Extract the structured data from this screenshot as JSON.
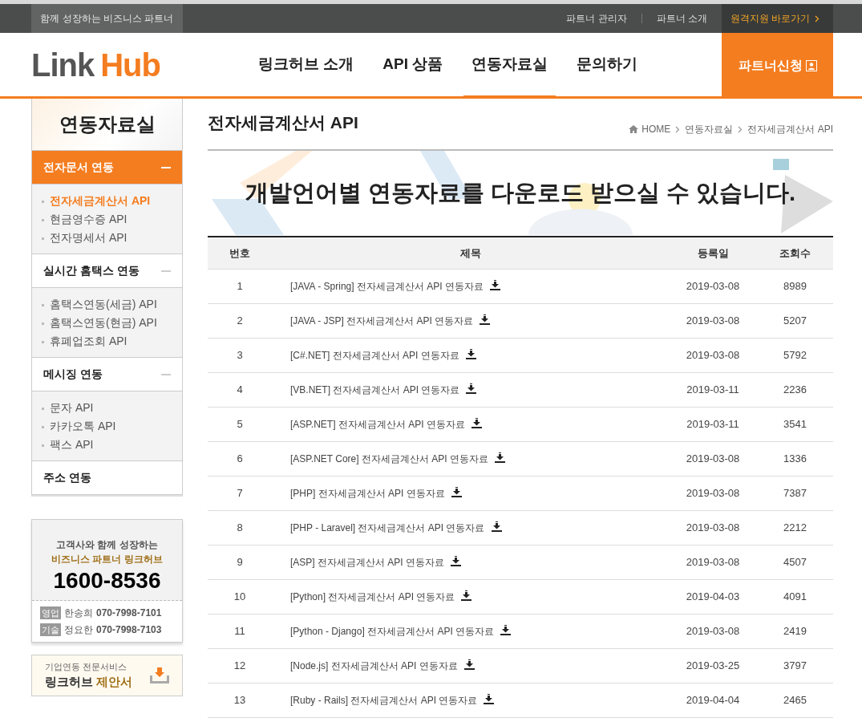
{
  "top_bar": {
    "tagline": "함께 성장하는 비즈니스 파트너",
    "links": [
      "파트너 관리자",
      "파트너 소개"
    ],
    "remote_link": "원격지원 바로가기"
  },
  "header": {
    "logo": {
      "part_1": "Link",
      "part_2": "Hub"
    },
    "nav": [
      {
        "label": "링크허브 소개",
        "selected": false
      },
      {
        "label": "API 상품",
        "selected": false
      },
      {
        "label": "연동자료실",
        "selected": true
      },
      {
        "label": "문의하기",
        "selected": false
      }
    ],
    "partner_button": "파트너신청"
  },
  "sidebar": {
    "title": "연동자료실",
    "groups": [
      {
        "label": "전자문서 연동",
        "selected": true,
        "expanded": true,
        "items": [
          {
            "label": "전자세금계산서 API",
            "selected": true
          },
          {
            "label": "현금영수증 API",
            "selected": false
          },
          {
            "label": "전자명세서 API",
            "selected": false
          }
        ]
      },
      {
        "label": "실시간 홈택스 연동",
        "selected": false,
        "expanded": true,
        "items": [
          {
            "label": "홈택스연동(세금) API",
            "selected": false
          },
          {
            "label": "홈택스연동(현금) API",
            "selected": false
          },
          {
            "label": "휴폐업조회 API",
            "selected": false
          }
        ]
      },
      {
        "label": "메시징 연동",
        "selected": false,
        "expanded": true,
        "items": [
          {
            "label": "문자 API",
            "selected": false
          },
          {
            "label": "카카오톡 API",
            "selected": false
          },
          {
            "label": "팩스 API",
            "selected": false
          }
        ]
      },
      {
        "label": "주소 연동",
        "selected": false,
        "expanded": false
      }
    ],
    "contact": {
      "line_1": "고객사와 함께 성장하는",
      "line_2": "비즈니스 파트너 링크허브",
      "phone": "1600-8536",
      "staff": [
        {
          "role": "영업",
          "name": "한송희",
          "phone": "070-7998-7101"
        },
        {
          "role": "기술",
          "name": "정요한",
          "phone": "070-7998-7103"
        }
      ]
    },
    "proposal": {
      "caption": "기업연동 전문서비스",
      "title_1": "링크허브",
      "title_2": "제안서"
    }
  },
  "content": {
    "title": "전자세금계산서 API",
    "breadcrumb": [
      "HOME",
      "연동자료실",
      "전자세금계산서 API"
    ],
    "banner": "개발언어별 연동자료를 다운로드 받으실 수 있습니다.",
    "table": {
      "columns": [
        "번호",
        "제목",
        "등록일",
        "조회수"
      ],
      "rows": [
        [
          "1",
          "[JAVA - Spring] 전자세금계산서 API 연동자료",
          "2019-03-08",
          "8989"
        ],
        [
          "2",
          "[JAVA - JSP] 전자세금계산서 API 연동자료",
          "2019-03-08",
          "5207"
        ],
        [
          "3",
          "[C#.NET] 전자세금계산서 API 연동자료",
          "2019-03-08",
          "5792"
        ],
        [
          "4",
          "[VB.NET] 전자세금계산서 API 연동자료",
          "2019-03-11",
          "2236"
        ],
        [
          "5",
          "[ASP.NET] 전자세금계산서 API 연동자료",
          "2019-03-11",
          "3541"
        ],
        [
          "6",
          "[ASP.NET Core] 전자세금계산서 API 연동자료",
          "2019-03-08",
          "1336"
        ],
        [
          "7",
          "[PHP] 전자세금계산서 API 연동자료",
          "2019-03-08",
          "7387"
        ],
        [
          "8",
          "[PHP - Laravel] 전자세금계산서 API 연동자료",
          "2019-03-08",
          "2212"
        ],
        [
          "9",
          "[ASP] 전자세금계산서 API 연동자료",
          "2019-03-08",
          "4507"
        ],
        [
          "10",
          "[Python] 전자세금계산서 API 연동자료",
          "2019-04-03",
          "4091"
        ],
        [
          "11",
          "[Python - Django] 전자세금계산서 API 연동자료",
          "2019-03-08",
          "2419"
        ],
        [
          "12",
          "[Node.js] 전자세금계산서 API 연동자료",
          "2019-03-25",
          "3797"
        ],
        [
          "13",
          "[Ruby - Rails] 전자세금계산서 API 연동자료",
          "2019-04-04",
          "2465"
        ]
      ]
    }
  }
}
